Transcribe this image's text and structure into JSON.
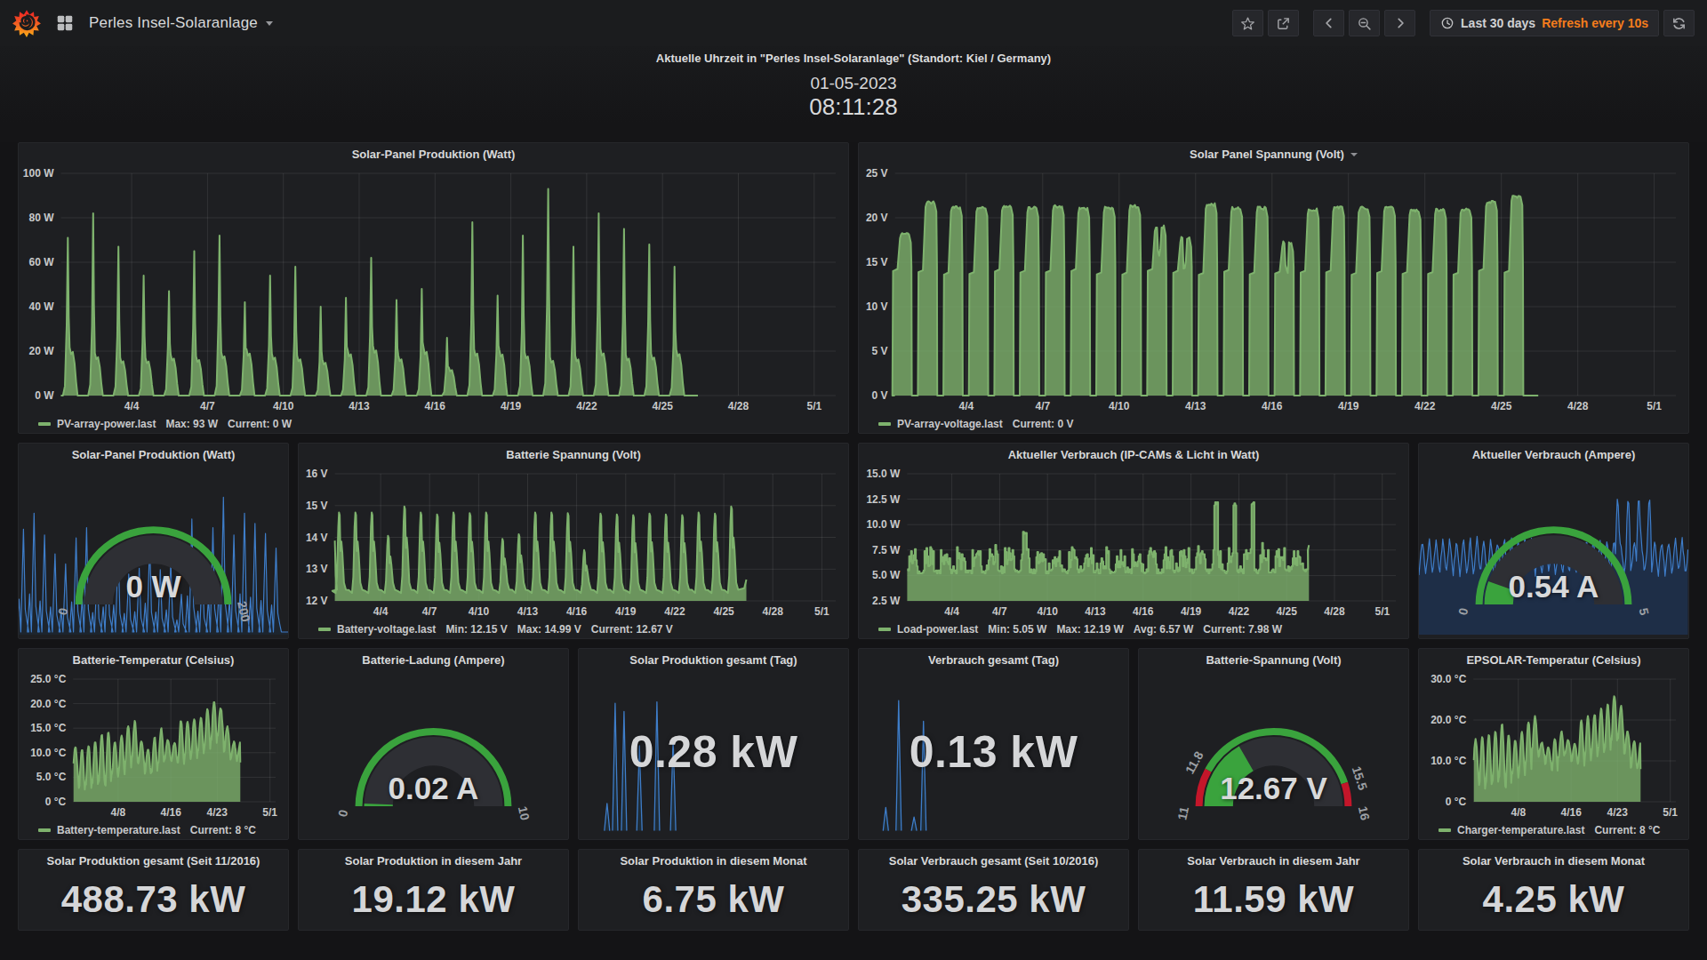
{
  "navbar": {
    "title": "Perles Insel-Solaranlage",
    "time_range": "Last 30 days",
    "refresh_interval": "Refresh every 10s",
    "icons": [
      "grafana-logo",
      "apps-icon",
      "chevron-down-icon",
      "star-icon",
      "share-icon",
      "chevron-left-icon",
      "zoom-out-icon",
      "chevron-right-icon",
      "clock-icon",
      "refresh-icon"
    ]
  },
  "clock": {
    "title": "Aktuelle Uhrzeit in \"Perles Insel-Solaranlage\" (Standort: Kiel / Germany)",
    "date": "01-05-2023",
    "time": "08:11:28"
  },
  "colors": {
    "green": "#7EB26D",
    "green_fill": "rgba(126,178,109,0.8)",
    "blue": "#3E7DC9",
    "blue_fill": "rgba(31,118,189,0.22)",
    "gauge_green": "#3AA33D",
    "gauge_red": "#C4162A",
    "gauge_body": "#2E2F34",
    "grid": "rgba(255,255,255,0.09)",
    "tick": "#c8c9ca",
    "orange": "#F57D1C"
  },
  "chart_data": {
    "pv_power": {
      "type": "area",
      "gen": "solar",
      "title": "Solar-Panel Produktion (Watt)",
      "ylabel": "W",
      "ylim": [
        0,
        100
      ],
      "domain": [
        0.2,
        30.85
      ],
      "yticks": [
        {
          "v": 0,
          "l": "0 W"
        },
        {
          "v": 20,
          "l": "20 W"
        },
        {
          "v": 40,
          "l": "40 W"
        },
        {
          "v": 60,
          "l": "60 W"
        },
        {
          "v": 80,
          "l": "80 W"
        },
        {
          "v": 100,
          "l": "100 W"
        }
      ],
      "xticks": [
        {
          "d": 3,
          "l": "4/4"
        },
        {
          "d": 6,
          "l": "4/7"
        },
        {
          "d": 9,
          "l": "4/10"
        },
        {
          "d": 12,
          "l": "4/13"
        },
        {
          "d": 15,
          "l": "4/16"
        },
        {
          "d": 18,
          "l": "4/19"
        },
        {
          "d": 21,
          "l": "4/22"
        },
        {
          "d": 24,
          "l": "4/25"
        },
        {
          "d": 27,
          "l": "4/28"
        },
        {
          "d": 30,
          "l": "5/1"
        }
      ],
      "day_peaks": [
        71,
        82,
        67,
        54,
        47,
        65,
        72,
        42,
        54,
        58,
        40,
        44,
        62,
        43,
        48,
        26,
        78,
        45,
        72,
        93,
        67,
        82,
        75,
        68,
        58
      ],
      "legend": {
        "name": "PV-array-power.last",
        "stats": [
          "Max: 93 W",
          "Current: 0 W"
        ]
      }
    },
    "pv_voltage": {
      "type": "area",
      "gen": "pulse",
      "has_menu": true,
      "title": "Solar Panel Spannung (Volt)",
      "ylabel": "V",
      "ylim": [
        0,
        25
      ],
      "domain": [
        0.2,
        30.85
      ],
      "yticks": [
        {
          "v": 0,
          "l": "0 V"
        },
        {
          "v": 5,
          "l": "5 V"
        },
        {
          "v": 10,
          "l": "10 V"
        },
        {
          "v": 15,
          "l": "15 V"
        },
        {
          "v": 20,
          "l": "20 V"
        },
        {
          "v": 25,
          "l": "25 V"
        }
      ],
      "xticks": [
        {
          "d": 3,
          "l": "4/4"
        },
        {
          "d": 6,
          "l": "4/7"
        },
        {
          "d": 9,
          "l": "4/10"
        },
        {
          "d": 12,
          "l": "4/13"
        },
        {
          "d": 15,
          "l": "4/16"
        },
        {
          "d": 18,
          "l": "4/19"
        },
        {
          "d": 21,
          "l": "4/22"
        },
        {
          "d": 24,
          "l": "4/25"
        },
        {
          "d": 27,
          "l": "4/28"
        },
        {
          "d": 30,
          "l": "5/1"
        }
      ],
      "day_peaks": [
        18.2,
        21.7,
        21.2,
        21.2,
        21.3,
        21.1,
        21.3,
        21.0,
        21.1,
        21.3,
        19.0,
        17.7,
        21.5,
        21.1,
        21.1,
        17.2,
        20.9,
        21.2,
        21.1,
        21.2,
        20.8,
        20.9,
        21.0,
        21.8,
        22.4
      ],
      "shoulder": 13.8,
      "legend": {
        "name": "PV-array-voltage.last",
        "stats": [
          "Current: 0 V"
        ]
      }
    },
    "batt_voltage": {
      "type": "area",
      "gen": "batt",
      "title": "Batterie Spannung (Volt)",
      "ylabel": "V",
      "ylim": [
        12,
        16
      ],
      "domain": [
        0.2,
        30.85
      ],
      "yticks": [
        {
          "v": 12,
          "l": "12 V"
        },
        {
          "v": 13,
          "l": "13 V"
        },
        {
          "v": 14,
          "l": "14 V"
        },
        {
          "v": 15,
          "l": "15 V"
        },
        {
          "v": 16,
          "l": "16 V"
        }
      ],
      "xticks": [
        {
          "d": 3,
          "l": "4/4"
        },
        {
          "d": 6,
          "l": "4/7"
        },
        {
          "d": 9,
          "l": "4/10"
        },
        {
          "d": 12,
          "l": "4/13"
        },
        {
          "d": 15,
          "l": "4/16"
        },
        {
          "d": 18,
          "l": "4/19"
        },
        {
          "d": 21,
          "l": "4/22"
        },
        {
          "d": 24,
          "l": "4/25"
        },
        {
          "d": 27,
          "l": "4/28"
        },
        {
          "d": 30,
          "l": "5/1"
        }
      ],
      "day_peaks": [
        14.78,
        14.78,
        14.78,
        14.05,
        14.97,
        14.78,
        14.72,
        14.78,
        14.76,
        14.78,
        13.95,
        14.1,
        14.78,
        14.78,
        14.76,
        13.6,
        14.75,
        14.72,
        14.7,
        14.75,
        14.72,
        14.7,
        14.78,
        14.75,
        14.97
      ],
      "night": 12.25,
      "end": 12.67,
      "legend": {
        "name": "Battery-voltage.last",
        "stats": [
          "Min: 12.15 V",
          "Max: 14.99 V",
          "Current: 12.67 V"
        ]
      }
    },
    "load_power": {
      "type": "area",
      "gen": "load",
      "title": "Aktueller Verbrauch (IP-CAMs & Licht in Watt)",
      "ylabel": "W",
      "ylim": [
        2.5,
        15
      ],
      "domain": [
        0.2,
        30.85
      ],
      "yticks": [
        {
          "v": 2.5,
          "l": "2.5 W"
        },
        {
          "v": 5,
          "l": "5.0 W"
        },
        {
          "v": 7.5,
          "l": "7.5 W"
        },
        {
          "v": 10,
          "l": "10.0 W"
        },
        {
          "v": 12.5,
          "l": "12.5 W"
        },
        {
          "v": 15,
          "l": "15.0 W"
        }
      ],
      "xticks": [
        {
          "d": 3,
          "l": "4/4"
        },
        {
          "d": 6,
          "l": "4/7"
        },
        {
          "d": 9,
          "l": "4/10"
        },
        {
          "d": 12,
          "l": "4/13"
        },
        {
          "d": 15,
          "l": "4/16"
        },
        {
          "d": 18,
          "l": "4/19"
        },
        {
          "d": 21,
          "l": "4/22"
        },
        {
          "d": 24,
          "l": "4/25"
        },
        {
          "d": 27,
          "l": "4/28"
        },
        {
          "d": 30,
          "l": "5/1"
        }
      ],
      "base": 5.15,
      "spikes": [
        {
          "d": 7.55,
          "v": 9.4
        },
        {
          "d": 19.55,
          "v": 12.2
        },
        {
          "d": 20.7,
          "v": 12.1
        },
        {
          "d": 21.85,
          "v": 12.2
        }
      ],
      "end": 7.98,
      "legend": {
        "name": "Load-power.last",
        "stats": [
          "Min: 5.05 W",
          "Max: 12.19 W",
          "Avg: 6.57 W",
          "Current: 7.98 W"
        ]
      }
    },
    "batt_temp": {
      "type": "area",
      "gen": "temp",
      "title": "Batterie-Temperatur (Celsius)",
      "ylabel": "°C",
      "ylim": [
        0,
        25
      ],
      "domain": [
        0.2,
        30.85
      ],
      "yticks": [
        {
          "v": 0,
          "l": "0 °C"
        },
        {
          "v": 5,
          "l": "5.0 °C"
        },
        {
          "v": 10,
          "l": "10.0 °C"
        },
        {
          "v": 15,
          "l": "15.0 °C"
        },
        {
          "v": 20,
          "l": "20.0 °C"
        },
        {
          "v": 25,
          "l": "25.0 °C"
        }
      ],
      "xticks": [
        {
          "d": 7,
          "l": "4/8"
        },
        {
          "d": 15,
          "l": "4/16"
        },
        {
          "d": 22,
          "l": "4/23"
        },
        {
          "d": 30,
          "l": "5/1"
        }
      ],
      "day_min": [
        4.5,
        2,
        2.5,
        3,
        3.5,
        2.5,
        5,
        5.5,
        7,
        8,
        7.5,
        5.5,
        5.5,
        7.5,
        8.5,
        8,
        7.5,
        8.5,
        9,
        9.5,
        10.5,
        11.5,
        13,
        10,
        8.5
      ],
      "day_max": [
        11.2,
        10.8,
        11.5,
        12.2,
        13.8,
        14.2,
        12.3,
        13.5,
        15.6,
        16.3,
        12.4,
        10.6,
        13.1,
        14.9,
        12.6,
        12.1,
        16.6,
        16.4,
        16.9,
        17.2,
        18.9,
        20.6,
        19.2,
        15.3,
        12.2
      ],
      "end": 8,
      "legend": {
        "name": "Battery-temperature.last",
        "stats": [
          "Current: 8 °C"
        ]
      }
    },
    "charger_temp": {
      "type": "area",
      "gen": "temp",
      "title": "EPSOLAR-Temperatur (Celsius)",
      "ylabel": "°C",
      "ylim": [
        0,
        30
      ],
      "domain": [
        0.2,
        30.85
      ],
      "yticks": [
        {
          "v": 0,
          "l": "0 °C"
        },
        {
          "v": 10,
          "l": "10.0 °C"
        },
        {
          "v": 20,
          "l": "20.0 °C"
        },
        {
          "v": 30,
          "l": "30.0 °C"
        }
      ],
      "xticks": [
        {
          "d": 7,
          "l": "4/8"
        },
        {
          "d": 15,
          "l": "4/16"
        },
        {
          "d": 22,
          "l": "4/23"
        },
        {
          "d": 30,
          "l": "5/1"
        }
      ],
      "day_min": [
        6,
        3,
        3.5,
        4,
        5,
        3,
        6,
        6.5,
        8,
        12,
        11,
        9,
        7,
        10.5,
        11.5,
        9.5,
        9,
        10,
        11,
        11.5,
        12,
        14,
        15,
        11.5,
        8
      ],
      "day_max": [
        15.3,
        15.9,
        16.4,
        17.4,
        18.9,
        16.4,
        15.1,
        17.2,
        19.4,
        20.8,
        14.4,
        13.2,
        15.4,
        17.1,
        15.2,
        14.4,
        19.9,
        20.9,
        21.4,
        22.9,
        23.9,
        26.1,
        23.4,
        17.2,
        14.8
      ],
      "end": 8,
      "legend": {
        "name": "Charger-temperature.last",
        "stats": [
          "Current: 8 °C"
        ]
      }
    },
    "gauge_pv": {
      "type": "gauge",
      "title": "Solar-Panel Produktion (Watt)",
      "value": "0 W",
      "min": "0",
      "max": "200",
      "fraction": 0,
      "ring": [
        {
          "f0": 0,
          "f1": 1,
          "c": "green"
        }
      ],
      "spark": {
        "kind": "spikes",
        "peaks": [
          71,
          82,
          67,
          54,
          47,
          65,
          72,
          42,
          54,
          58,
          40,
          44,
          62,
          43,
          48,
          26,
          78,
          45,
          72,
          93,
          67,
          82,
          75,
          68,
          58
        ],
        "scale": 100
      }
    },
    "gauge_amp": {
      "type": "gauge",
      "title": "Aktueller Verbrauch (Ampere)",
      "value": "0.54 A",
      "min": "0",
      "max": "5",
      "fraction": 0.108,
      "ring": [
        {
          "f0": 0,
          "f1": 1,
          "c": "green"
        }
      ],
      "spark": {
        "kind": "band",
        "lo": 0.44,
        "hi": 0.74,
        "spike_lo": 18.5,
        "spike_hi": 22.0,
        "scale": 1.15
      }
    },
    "gauge_charge": {
      "type": "gauge",
      "title": "Batterie-Ladung (Ampere)",
      "value": "0.02 A",
      "min": "0",
      "max": "10",
      "fraction": 0.002,
      "ring": [
        {
          "f0": 0,
          "f1": 1,
          "c": "green"
        }
      ]
    },
    "gauge_batt": {
      "type": "gauge",
      "title": "Batterie-Spannung (Volt)",
      "value": "12.67 V",
      "min": "11",
      "max": "16",
      "fraction": 0.334,
      "ring": [
        {
          "f0": 0,
          "f1": 0.16,
          "c": "red"
        },
        {
          "f0": 0.16,
          "f1": 0.9,
          "c": "green"
        },
        {
          "f0": 0.9,
          "f1": 1,
          "c": "red"
        }
      ],
      "labels": [
        {
          "f": 0,
          "t": "11"
        },
        {
          "f": 0.16,
          "t": "11.8"
        },
        {
          "f": 0.9,
          "t": "15.5"
        },
        {
          "f": 1,
          "t": "16"
        }
      ]
    },
    "stat_prod_day": {
      "type": "stat",
      "title": "Solar Produktion gesamt (Tag)",
      "value": "0.28 kW",
      "spikes": [
        {
          "x": 0.105,
          "h": 0.2
        },
        {
          "x": 0.135,
          "h": 0.93
        },
        {
          "x": 0.168,
          "h": 0.87
        },
        {
          "x": 0.225,
          "h": 0.62
        },
        {
          "x": 0.29,
          "h": 0.94
        },
        {
          "x": 0.35,
          "h": 0.67
        }
      ]
    },
    "stat_cons_day": {
      "type": "stat",
      "title": "Verbrauch gesamt (Tag)",
      "value": "0.13 kW",
      "spikes": [
        {
          "x": 0.1,
          "h": 0.17
        },
        {
          "x": 0.148,
          "h": 0.95
        },
        {
          "x": 0.205,
          "h": 0.1
        },
        {
          "x": 0.24,
          "h": 0.8
        }
      ]
    }
  },
  "stats_row": [
    {
      "title": "Solar Produktion gesamt (Seit 11/2016)",
      "value": "488.73 kW"
    },
    {
      "title": "Solar Produktion in diesem Jahr",
      "value": "19.12 kW"
    },
    {
      "title": "Solar Produktion in diesem Monat",
      "value": "6.75 kW"
    },
    {
      "title": "Solar Verbrauch gesamt (Seit 10/2016)",
      "value": "335.25 kW"
    },
    {
      "title": "Solar Verbrauch in diesem Jahr",
      "value": "11.59 kW"
    },
    {
      "title": "Solar Verbrauch in diesem Monat",
      "value": "4.25 kW"
    }
  ]
}
